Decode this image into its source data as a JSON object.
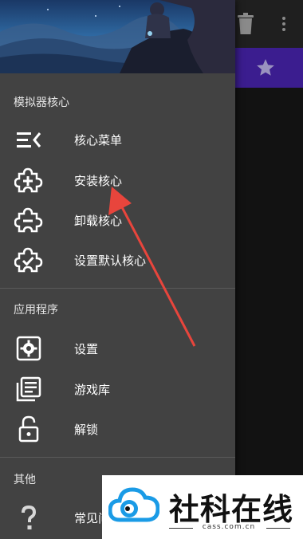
{
  "colors": {
    "drawer_bg": "#424242",
    "tab_accent": "#3b1d8f",
    "annotation": "#e8453c",
    "watermark_blue": "#1a9be6"
  },
  "background": {
    "toolbar_icons": [
      "trash-icon",
      "more-vert-icon"
    ],
    "tab_icon": "star-icon"
  },
  "drawer": {
    "sections": [
      {
        "title": "模拟器核心",
        "items": [
          {
            "label": "核心菜单",
            "icon": "menu-collapse-icon"
          },
          {
            "label": "安装核心",
            "icon": "puzzle-plus-icon"
          },
          {
            "label": "卸载核心",
            "icon": "puzzle-minus-icon"
          },
          {
            "label": "设置默认核心",
            "icon": "puzzle-check-icon"
          }
        ]
      },
      {
        "title": "应用程序",
        "items": [
          {
            "label": "设置",
            "icon": "gear-icon"
          },
          {
            "label": "游戏库",
            "icon": "library-icon"
          },
          {
            "label": "解锁",
            "icon": "unlock-icon"
          }
        ]
      },
      {
        "title": "其他",
        "items": [
          {
            "label": "常见问",
            "icon": "help-icon"
          }
        ]
      }
    ]
  },
  "watermark": {
    "title": "社科在线",
    "url": "cass.com.cn"
  }
}
